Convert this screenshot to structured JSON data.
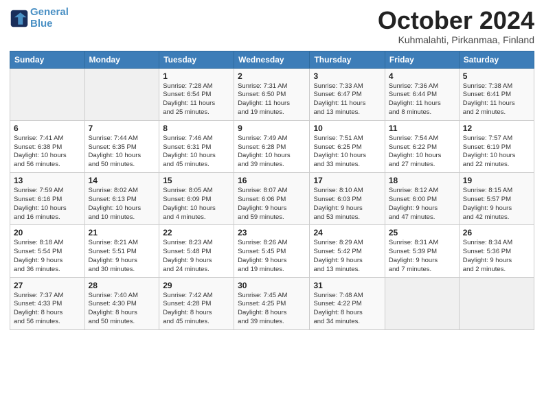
{
  "header": {
    "logo_line1": "General",
    "logo_line2": "Blue",
    "month": "October 2024",
    "location": "Kuhmalahti, Pirkanmaa, Finland"
  },
  "days_of_week": [
    "Sunday",
    "Monday",
    "Tuesday",
    "Wednesday",
    "Thursday",
    "Friday",
    "Saturday"
  ],
  "weeks": [
    [
      {
        "num": "",
        "info": ""
      },
      {
        "num": "",
        "info": ""
      },
      {
        "num": "1",
        "info": "Sunrise: 7:28 AM\nSunset: 6:54 PM\nDaylight: 11 hours\nand 25 minutes."
      },
      {
        "num": "2",
        "info": "Sunrise: 7:31 AM\nSunset: 6:50 PM\nDaylight: 11 hours\nand 19 minutes."
      },
      {
        "num": "3",
        "info": "Sunrise: 7:33 AM\nSunset: 6:47 PM\nDaylight: 11 hours\nand 13 minutes."
      },
      {
        "num": "4",
        "info": "Sunrise: 7:36 AM\nSunset: 6:44 PM\nDaylight: 11 hours\nand 8 minutes."
      },
      {
        "num": "5",
        "info": "Sunrise: 7:38 AM\nSunset: 6:41 PM\nDaylight: 11 hours\nand 2 minutes."
      }
    ],
    [
      {
        "num": "6",
        "info": "Sunrise: 7:41 AM\nSunset: 6:38 PM\nDaylight: 10 hours\nand 56 minutes."
      },
      {
        "num": "7",
        "info": "Sunrise: 7:44 AM\nSunset: 6:35 PM\nDaylight: 10 hours\nand 50 minutes."
      },
      {
        "num": "8",
        "info": "Sunrise: 7:46 AM\nSunset: 6:31 PM\nDaylight: 10 hours\nand 45 minutes."
      },
      {
        "num": "9",
        "info": "Sunrise: 7:49 AM\nSunset: 6:28 PM\nDaylight: 10 hours\nand 39 minutes."
      },
      {
        "num": "10",
        "info": "Sunrise: 7:51 AM\nSunset: 6:25 PM\nDaylight: 10 hours\nand 33 minutes."
      },
      {
        "num": "11",
        "info": "Sunrise: 7:54 AM\nSunset: 6:22 PM\nDaylight: 10 hours\nand 27 minutes."
      },
      {
        "num": "12",
        "info": "Sunrise: 7:57 AM\nSunset: 6:19 PM\nDaylight: 10 hours\nand 22 minutes."
      }
    ],
    [
      {
        "num": "13",
        "info": "Sunrise: 7:59 AM\nSunset: 6:16 PM\nDaylight: 10 hours\nand 16 minutes."
      },
      {
        "num": "14",
        "info": "Sunrise: 8:02 AM\nSunset: 6:13 PM\nDaylight: 10 hours\nand 10 minutes."
      },
      {
        "num": "15",
        "info": "Sunrise: 8:05 AM\nSunset: 6:09 PM\nDaylight: 10 hours\nand 4 minutes."
      },
      {
        "num": "16",
        "info": "Sunrise: 8:07 AM\nSunset: 6:06 PM\nDaylight: 9 hours\nand 59 minutes."
      },
      {
        "num": "17",
        "info": "Sunrise: 8:10 AM\nSunset: 6:03 PM\nDaylight: 9 hours\nand 53 minutes."
      },
      {
        "num": "18",
        "info": "Sunrise: 8:12 AM\nSunset: 6:00 PM\nDaylight: 9 hours\nand 47 minutes."
      },
      {
        "num": "19",
        "info": "Sunrise: 8:15 AM\nSunset: 5:57 PM\nDaylight: 9 hours\nand 42 minutes."
      }
    ],
    [
      {
        "num": "20",
        "info": "Sunrise: 8:18 AM\nSunset: 5:54 PM\nDaylight: 9 hours\nand 36 minutes."
      },
      {
        "num": "21",
        "info": "Sunrise: 8:21 AM\nSunset: 5:51 PM\nDaylight: 9 hours\nand 30 minutes."
      },
      {
        "num": "22",
        "info": "Sunrise: 8:23 AM\nSunset: 5:48 PM\nDaylight: 9 hours\nand 24 minutes."
      },
      {
        "num": "23",
        "info": "Sunrise: 8:26 AM\nSunset: 5:45 PM\nDaylight: 9 hours\nand 19 minutes."
      },
      {
        "num": "24",
        "info": "Sunrise: 8:29 AM\nSunset: 5:42 PM\nDaylight: 9 hours\nand 13 minutes."
      },
      {
        "num": "25",
        "info": "Sunrise: 8:31 AM\nSunset: 5:39 PM\nDaylight: 9 hours\nand 7 minutes."
      },
      {
        "num": "26",
        "info": "Sunrise: 8:34 AM\nSunset: 5:36 PM\nDaylight: 9 hours\nand 2 minutes."
      }
    ],
    [
      {
        "num": "27",
        "info": "Sunrise: 7:37 AM\nSunset: 4:33 PM\nDaylight: 8 hours\nand 56 minutes."
      },
      {
        "num": "28",
        "info": "Sunrise: 7:40 AM\nSunset: 4:30 PM\nDaylight: 8 hours\nand 50 minutes."
      },
      {
        "num": "29",
        "info": "Sunrise: 7:42 AM\nSunset: 4:28 PM\nDaylight: 8 hours\nand 45 minutes."
      },
      {
        "num": "30",
        "info": "Sunrise: 7:45 AM\nSunset: 4:25 PM\nDaylight: 8 hours\nand 39 minutes."
      },
      {
        "num": "31",
        "info": "Sunrise: 7:48 AM\nSunset: 4:22 PM\nDaylight: 8 hours\nand 34 minutes."
      },
      {
        "num": "",
        "info": ""
      },
      {
        "num": "",
        "info": ""
      }
    ]
  ]
}
